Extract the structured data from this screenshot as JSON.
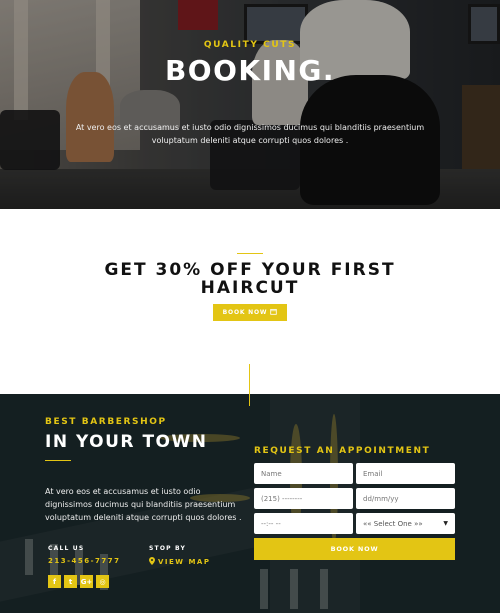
{
  "hero": {
    "eyebrow": "QUALITY CUTS",
    "title": "BOOKING.",
    "text": "At vero eos et accusamus et iusto odio dignissimos ducimus qui blanditiis praesentium voluptatum deleniti atque corrupti quos dolores ."
  },
  "promo": {
    "title": "GET 30% OFF YOUR FIRST HAIRCUT",
    "button": "BOOK NOW"
  },
  "about": {
    "eyebrow": "BEST BARBERSHOP",
    "title": "IN YOUR TOWN",
    "text": "At vero eos et accusamus et iusto odio dignissimos ducimus qui blanditiis praesentium voluptatum deleniti atque corrupti quos dolores .",
    "call_label": "CALL US",
    "call_value": "213-456-7777",
    "stop_label": "STOP BY",
    "stop_value": "VIEW MAP",
    "socials": [
      "f",
      "t",
      "G+",
      "◎"
    ]
  },
  "appointment": {
    "title": "REQUEST AN APPOINTMENT",
    "name_placeholder": "Name",
    "email_placeholder": "Email",
    "phone_placeholder": "(215) --------",
    "date_placeholder": "dd/mm/yy",
    "time_placeholder": "--:-- --",
    "select_value": "«« Select One »»",
    "submit": "BOOK NOW"
  },
  "colors": {
    "accent": "#e3c514",
    "dark": "#1c2729"
  }
}
